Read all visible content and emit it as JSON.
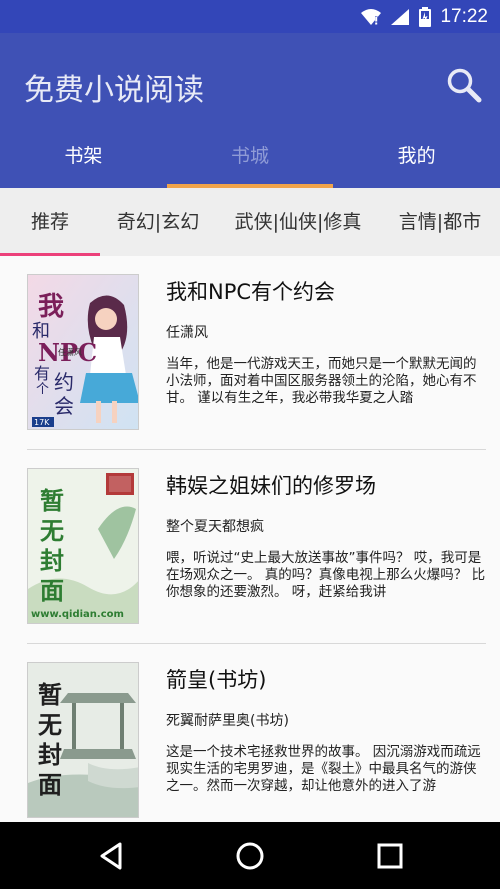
{
  "status": {
    "time": "17:22"
  },
  "app": {
    "title": "免费小说阅读"
  },
  "main_tabs": [
    {
      "label": "书架",
      "active": false
    },
    {
      "label": "书城",
      "active": true
    },
    {
      "label": "我的",
      "active": false
    }
  ],
  "categories": [
    {
      "label": "推荐",
      "active": true
    },
    {
      "label": "奇幻|玄幻",
      "active": false
    },
    {
      "label": "武侠|仙侠|修真",
      "active": false
    },
    {
      "label": "言情|都市",
      "active": false
    }
  ],
  "books": [
    {
      "title": "我和NPC有个约会",
      "author": "任潇风",
      "desc": "当年，他是一代游戏天王，而她只是一个默默无闻的小法师，面对着中国区服务器领土的沦陷，她心有不甘。   谨以有生之年，我必带我华夏之人踏",
      "cover": {
        "text": "我和NPC有个约会",
        "author": "任潇风",
        "badge": "17K"
      }
    },
    {
      "title": "韩娱之姐妹们的修罗场",
      "author": "整个夏天都想疯",
      "desc": "喂，听说过“史上最大放送事故”事件吗？   哎，我可是在场观众之一。   真的吗？真像电视上那么火爆吗？   比你想象的还要激烈。   呀，赶紧给我讲",
      "cover": {
        "text": "暂无封面",
        "site": "www.qidian.com"
      }
    },
    {
      "title": "箭皇(书坊)",
      "author": "死翼耐萨里奥(书坊)",
      "desc": "这是一个技术宅拯救世界的故事。   因沉溺游戏而疏远现实生活的宅男罗迪，是《裂土》中最具名气的游侠之一。然而一次穿越，却让他意外的进入了游",
      "cover": {
        "text": "暂无封面"
      }
    }
  ],
  "colors": {
    "primary": "#3f51b5",
    "status": "#3346b8",
    "tab_indicator": "#f0a34a",
    "category_indicator": "#ec407a"
  }
}
